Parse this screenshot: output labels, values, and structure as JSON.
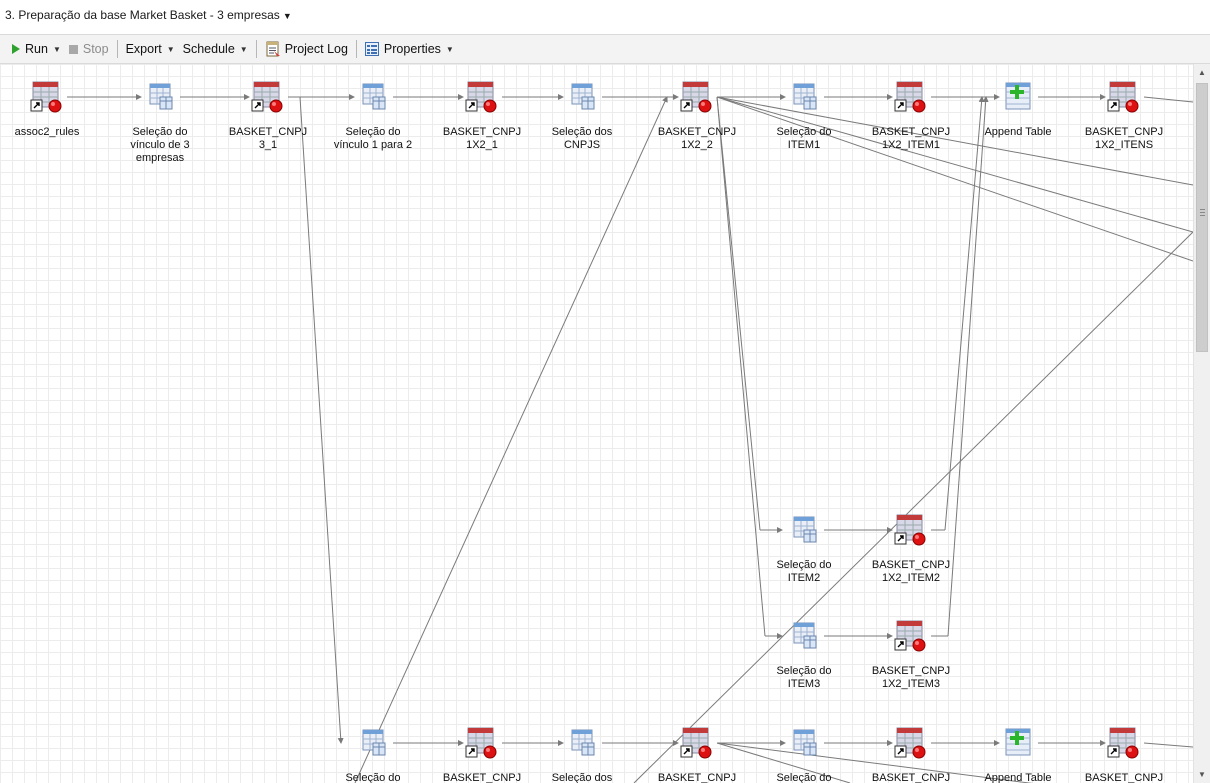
{
  "title_bar": {
    "project_title": "3. Preparação da base Market Basket - 3 empresas"
  },
  "toolbar": {
    "run": "Run",
    "stop": "Stop",
    "export": "Export",
    "schedule": "Schedule",
    "project_log": "Project Log",
    "properties": "Properties"
  },
  "colors": {
    "run_icon": "#2ea12e",
    "edge": "#7a7a7a",
    "query_icon": "#6fa0d8",
    "table_icon": "#d8d8e8",
    "table_header": "#c33a3a",
    "append_plus": "#2bb52b",
    "grid": "#ececec"
  },
  "flow": {
    "nodes": [
      {
        "label": "assoc2_rules",
        "icon": "table-shortcut-icon"
      },
      {
        "label": "Seleção do\nvínculo de 3\nempresas",
        "icon": "query-icon"
      },
      {
        "label": "BASKET_CNPJ\n3_1",
        "icon": "table-shortcut-icon"
      },
      {
        "label": "Seleção do\nvínculo 1 para 2",
        "icon": "query-icon"
      },
      {
        "label": "BASKET_CNPJ\n1X2_1",
        "icon": "table-shortcut-icon"
      },
      {
        "label": "Seleção dos\nCNPJS",
        "icon": "query-icon"
      },
      {
        "label": "BASKET_CNPJ\n1X2_2",
        "icon": "table-shortcut-icon"
      },
      {
        "label": "Seleção do\nITEM1",
        "icon": "query-icon"
      },
      {
        "label": "BASKET_CNPJ\n1X2_ITEM1",
        "icon": "table-shortcut-icon"
      },
      {
        "label": "Append Table",
        "icon": "append-table-icon"
      },
      {
        "label": "BASKET_CNPJ\n1X2_ITENS",
        "icon": "table-shortcut-icon"
      },
      {
        "label": "Seleção do\nITEM2",
        "icon": "query-icon"
      },
      {
        "label": "BASKET_CNPJ\n1X2_ITEM2",
        "icon": "table-shortcut-icon"
      },
      {
        "label": "Seleção do\nITEM3",
        "icon": "query-icon"
      },
      {
        "label": "BASKET_CNPJ\n1X2_ITEM3",
        "icon": "table-shortcut-icon"
      },
      {
        "label": "Seleção do",
        "icon": "query-icon"
      },
      {
        "label": "BASKET_CNPJ",
        "icon": "table-shortcut-icon"
      },
      {
        "label": "Seleção dos",
        "icon": "query-icon"
      },
      {
        "label": "BASKET_CNPJ",
        "icon": "table-shortcut-icon"
      },
      {
        "label": "Seleção do",
        "icon": "query-icon"
      },
      {
        "label": "BASKET_CNPJ",
        "icon": "table-shortcut-icon"
      },
      {
        "label": "Append Table",
        "icon": "append-table-icon"
      },
      {
        "label": "BASKET_CNPJ",
        "icon": "table-shortcut-icon"
      }
    ]
  }
}
